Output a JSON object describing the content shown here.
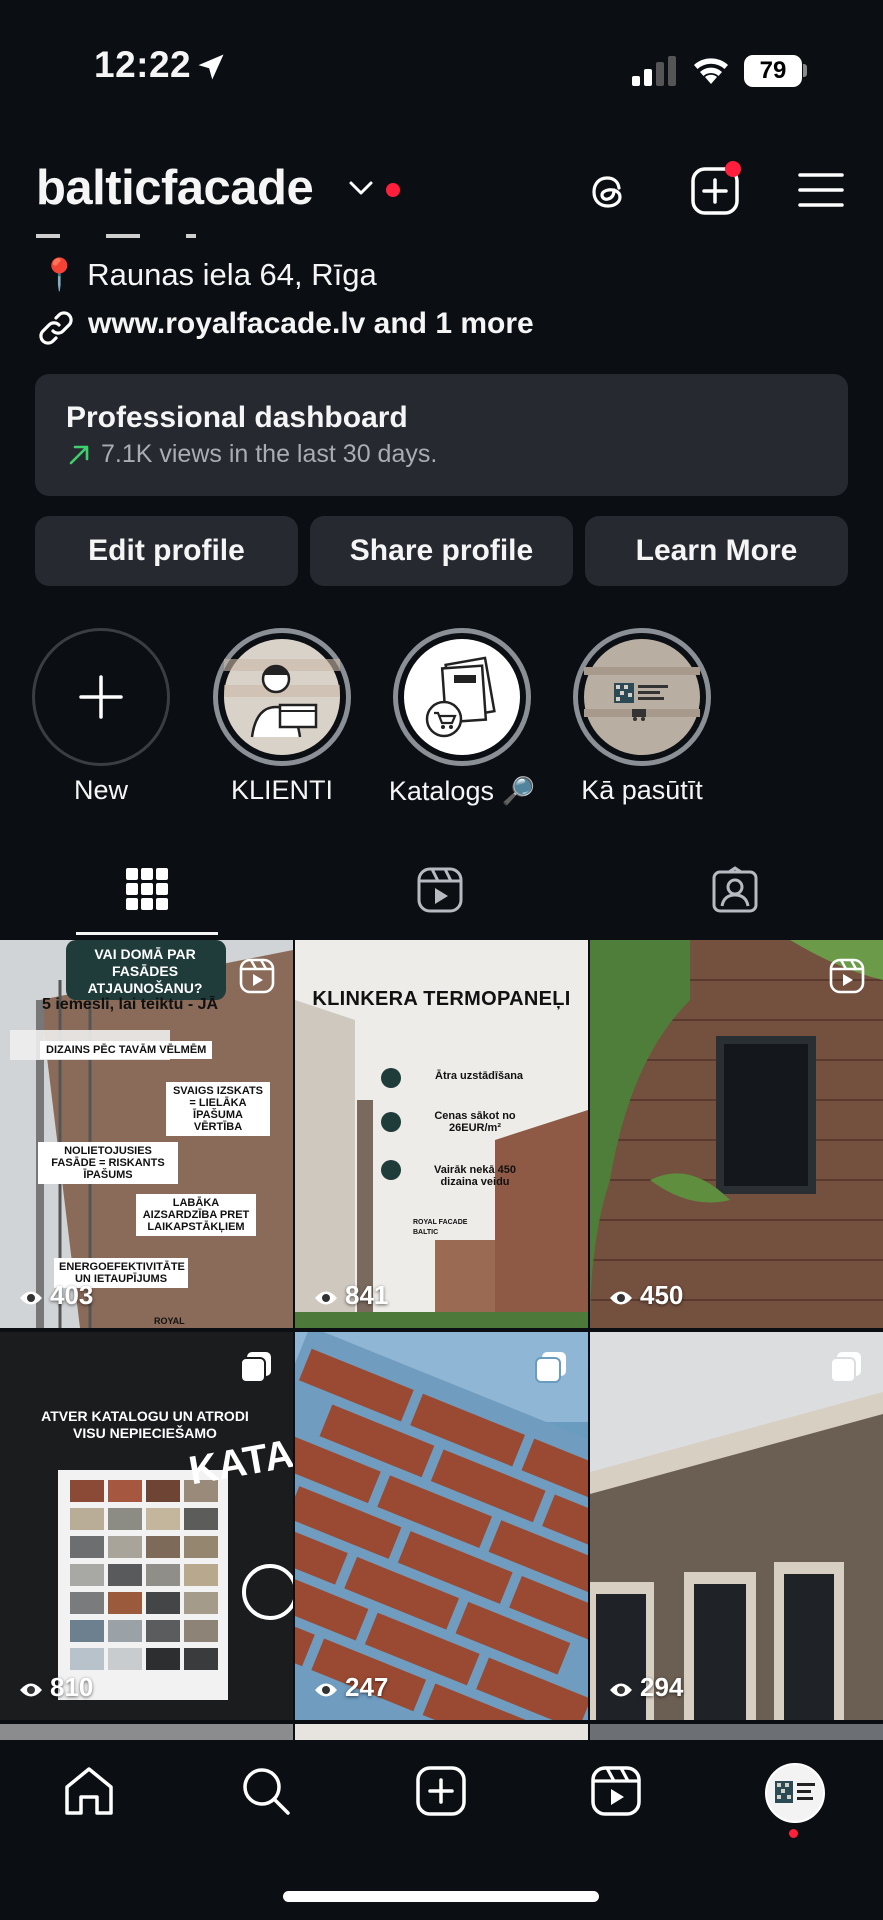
{
  "status_bar": {
    "time": "12:22",
    "battery": "79"
  },
  "header": {
    "username": "balticfacade"
  },
  "bio": {
    "address": "📍 Raunas iela 64, Rīga",
    "link": "www.royalfacade.lv and 1 more"
  },
  "dashboard": {
    "title": "Professional dashboard",
    "subtitle": "7.1K views in the last 30 days."
  },
  "buttons": [
    "Edit profile",
    "Share profile",
    "Learn More"
  ],
  "highlights": [
    {
      "label": "New",
      "icon": "plus-icon"
    },
    {
      "label": "KLIENTI",
      "icon": "courier-icon"
    },
    {
      "label": "Katalogs 🔎",
      "icon": "catalog-cart-icon"
    },
    {
      "label": "Kā pasūtīt",
      "icon": "royal-facade-logo"
    }
  ],
  "tabs": [
    "grid-icon",
    "reels-icon",
    "tagged-icon"
  ],
  "posts": [
    {
      "views": "403",
      "type": "reel",
      "heading": "VAI DOMĀ PAR FASĀDES ATJAUNOŠANU?",
      "subheading": "5 iemesli, lai teiktu - JĀ",
      "points": [
        "DIZAINS PĒC TAVĀM VĒLMĒM",
        "SVAIGS IZSKATS = LIELĀKA ĪPAŠUMA VĒRTĪBA",
        "NOLIETOJUSIES FASĀDE = RISKANTS ĪPAŠUMS",
        "LABĀKA AIZSARDZĪBA PRET LAIKAPSTĀKĻIEM",
        "ENERGOEFEKTIVITĀTE UN IETAUPĪJUMS"
      ],
      "footer": "ROYAL"
    },
    {
      "views": "841",
      "type": "reel",
      "heading": "KLINKERA TERMOPANEĻI",
      "points": [
        "Ātra uzstādīšana",
        "Cenas sākot no 26EUR/m²",
        "Vairāk nekā 450 dizaina veidu"
      ],
      "logo": "ROYAL FACADE BALTIC"
    },
    {
      "views": "450",
      "type": "reel"
    },
    {
      "views": "810",
      "type": "carousel",
      "heading": "ATVER KATALOGU UN ATRODI VISU NEPIECIEŠAMO",
      "side_text": "KATALOGS"
    },
    {
      "views": "247",
      "type": "carousel"
    },
    {
      "views": "294",
      "type": "carousel"
    }
  ],
  "nav": [
    "home-icon",
    "search-icon",
    "create-icon",
    "reels-icon",
    "profile-avatar"
  ],
  "colors": {
    "background": "#0b0e13",
    "card": "#262a30",
    "accent_red": "#ff1f3d",
    "trend_green": "#3ecf6e"
  }
}
